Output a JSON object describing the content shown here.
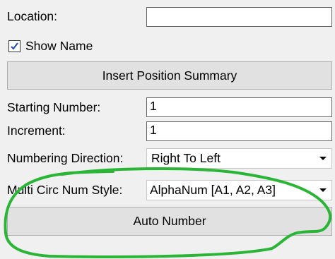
{
  "location": {
    "label": "Location:",
    "value": ""
  },
  "show_name": {
    "label": "Show Name",
    "checked": true
  },
  "insert_summary_button": "Insert Position Summary",
  "starting_number": {
    "label": "Starting Number:",
    "value": "1"
  },
  "increment": {
    "label": "Increment:",
    "value": "1"
  },
  "numbering_direction": {
    "label": "Numbering Direction:",
    "value": "Right To Left"
  },
  "multi_circ": {
    "label": "Multi Circ Num Style:",
    "value": "AlphaNum [A1, A2, A3]"
  },
  "auto_number_button": "Auto Number",
  "annotation_color": "#2ab537"
}
